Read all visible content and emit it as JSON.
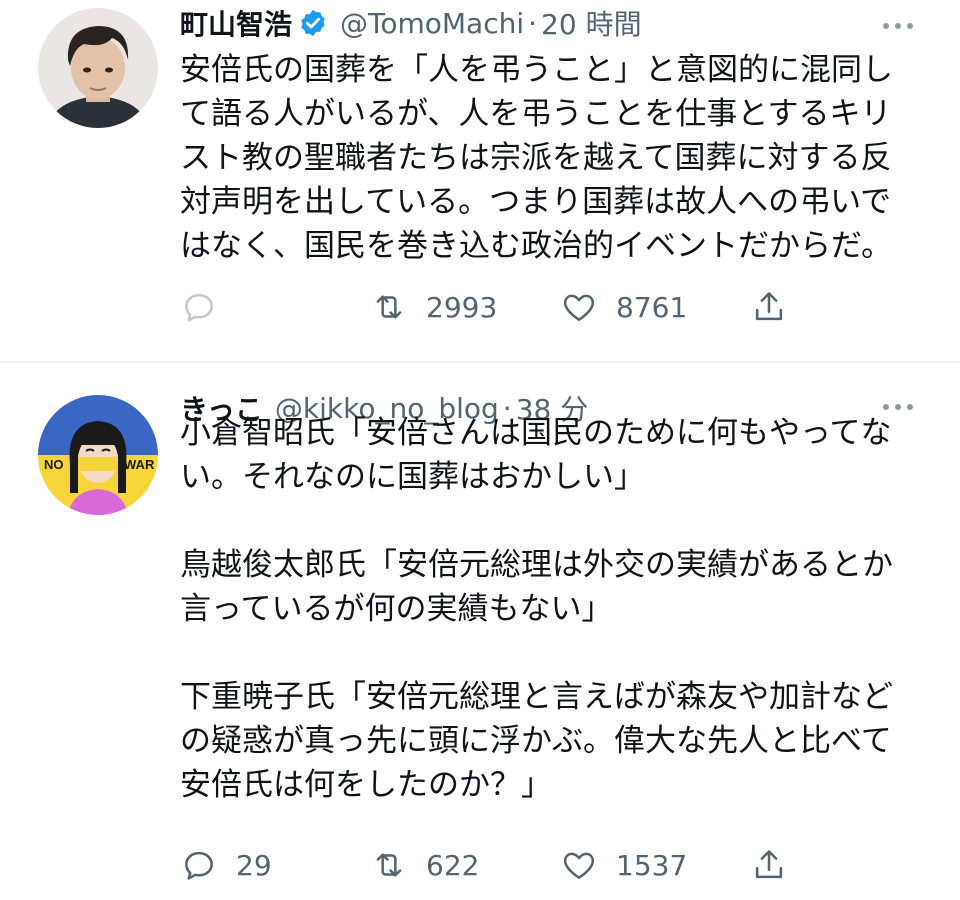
{
  "tweets": [
    {
      "author": {
        "name": "町山智浩",
        "handle": "@TomoMachi",
        "verified": true
      },
      "separator": "·",
      "time": "20 時間",
      "text_lines": [
        "安倍氏の国葬を「人を弔うこと」と意図的に混同し",
        "て語る人がいるが、人を弔うことを仕事とするキリ",
        "スト教の聖職者たちは宗派を越えて国葬に対する反",
        "対声明を出している。つまり国葬は故人への弔いで",
        "はなく、国民を巻き込む政治的イベントだからだ。"
      ],
      "actions": {
        "reply": "",
        "retweet": "2993",
        "like": "8761"
      }
    },
    {
      "author": {
        "name": "きっこ",
        "handle": "@kikko_no_blog",
        "verified": false
      },
      "separator": "·",
      "time": "38 分",
      "avatar_text": {
        "left": "NO",
        "right": "WAR"
      },
      "text_paragraphs": [
        [
          "小倉智昭氏「安倍さんは国民のために何もやってな",
          "い。それなのに国葬はおかしい」"
        ],
        [
          "鳥越俊太郎氏「安倍元総理は外交の実績があるとか",
          "言っているが何の実績もない」"
        ],
        [
          "下重暁子氏「安倍元総理と言えばが森友や加計など",
          "の疑惑が真っ先に頭に浮かぶ。偉大な先人と比べて",
          "安倍氏は何をしたのか？」"
        ]
      ],
      "actions": {
        "reply": "29",
        "retweet": "622",
        "like": "1537"
      }
    }
  ],
  "colors": {
    "text": "#0f1419",
    "secondary": "#536471",
    "verified": "#1d9bf0",
    "divider": "#eff3f4"
  },
  "icons": [
    "reply-icon",
    "retweet-icon",
    "like-icon",
    "share-icon",
    "more-icon",
    "verified-badge-icon"
  ]
}
